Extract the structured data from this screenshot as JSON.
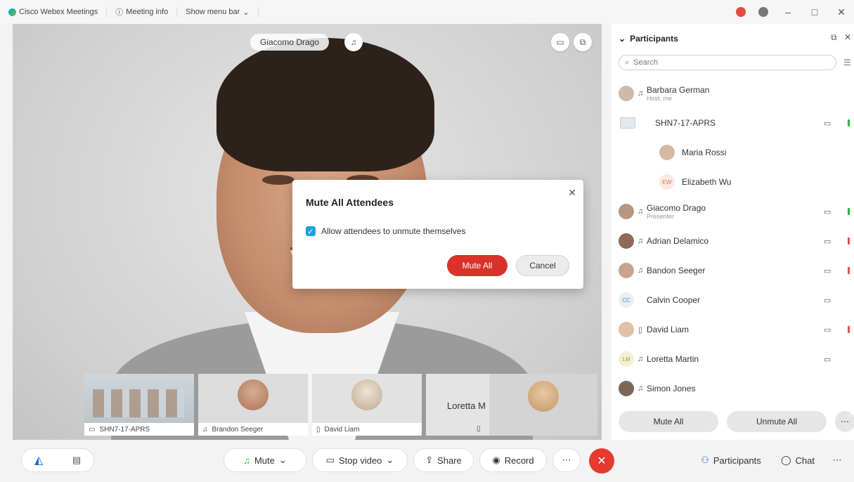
{
  "titlebar": {
    "app_name": "Cisco Webex Meetings",
    "meeting_info": "Meeting info",
    "menu_bar": "Show menu bar"
  },
  "stage": {
    "presenter_name": "Giacomo Drago"
  },
  "dialog": {
    "title": "Mute All Attendees",
    "checkbox_label": "Allow attendees to unmute themselves",
    "checkbox_checked": true,
    "primary_button": "Mute All",
    "secondary_button": "Cancel"
  },
  "thumbnails": [
    {
      "label": "SHN7-17-APRS"
    },
    {
      "label": "Brandon Seeger"
    },
    {
      "label": "David Liam"
    },
    {
      "label": "Loretta M",
      "display_text": "Loretta M"
    }
  ],
  "panel": {
    "title": "Participants",
    "search_placeholder": "Search",
    "participants": [
      {
        "name": "Barbara German",
        "role": "Host, me"
      },
      {
        "name": "SHN7-17-APRS"
      },
      {
        "name": "Maria Rossi"
      },
      {
        "name": "Elizabeth Wu",
        "initials": "EW"
      },
      {
        "name": "Giacomo Drago",
        "role": "Presenter"
      },
      {
        "name": "Adrian Delamico"
      },
      {
        "name": "Bandon Seeger"
      },
      {
        "name": "Calvin Cooper",
        "initials": "CC"
      },
      {
        "name": "David Liam"
      },
      {
        "name": "Loretta Martin",
        "initials": "LM"
      },
      {
        "name": "Simon Jones"
      }
    ],
    "mute_all": "Mute All",
    "unmute_all": "Unmute All"
  },
  "toolbar": {
    "mute": "Mute",
    "stop_video": "Stop video",
    "share": "Share",
    "record": "Record",
    "participants": "Participants",
    "chat": "Chat"
  },
  "colors": {
    "accent": "#1aa3d8",
    "danger": "#d9322a",
    "level_green": "#2bb24c",
    "level_red": "#e0504a"
  }
}
